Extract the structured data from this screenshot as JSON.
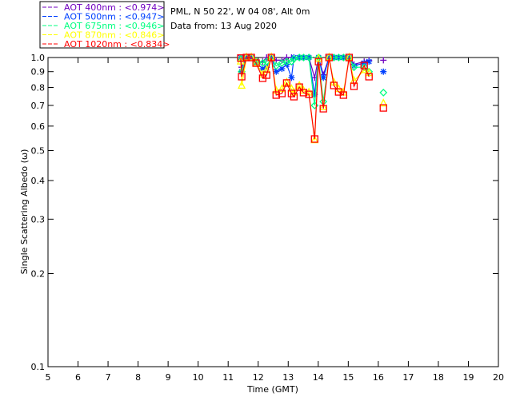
{
  "chart_data": {
    "type": "line",
    "title_lines": [
      "PML, N 50 22', W 04 08', Alt 0m",
      "Data from: 13 Aug 2020"
    ],
    "xlabel": "Time (GMT)",
    "ylabel": "Single Scattering Albedo (ω)",
    "xlim": [
      5,
      20
    ],
    "ylim": [
      0.1,
      1.0
    ],
    "yscale": "log",
    "xticks": [
      "5",
      "6",
      "7",
      "8",
      "9",
      "10",
      "11",
      "12",
      "13",
      "14",
      "15",
      "16",
      "17",
      "18",
      "19",
      "20"
    ],
    "yticks": [
      {
        "v": 1.0,
        "label": "1.0"
      },
      {
        "v": 0.9,
        "label": "0.9"
      },
      {
        "v": 0.8,
        "label": "0.8"
      },
      {
        "v": 0.7,
        "label": "0.7"
      },
      {
        "v": 0.6,
        "label": "0.6"
      },
      {
        "v": 0.5,
        "label": "0.5"
      },
      {
        "v": 0.4,
        "label": "0.4"
      },
      {
        "v": 0.3,
        "label": "0.3"
      },
      {
        "v": 0.2,
        "label": "0.2"
      },
      {
        "v": 0.1,
        "label": "0.1"
      }
    ],
    "legend_position": "top-left-outside",
    "x": [
      11.42,
      11.45,
      11.61,
      11.77,
      11.93,
      12.15,
      12.28,
      12.44,
      12.6,
      12.79,
      12.95,
      13.11,
      13.19,
      13.37,
      13.51,
      13.69,
      13.88,
      14.01,
      14.17,
      14.36,
      14.52,
      14.68,
      14.84,
      15.03,
      15.19,
      15.53,
      15.69,
      16.17
    ],
    "series": [
      {
        "name": "AOT  400nm : <0.974>",
        "color": "#7000c0",
        "marker": "plus",
        "values": [
          1.0,
          0.93,
          1.0,
          1.0,
          0.97,
          0.97,
          1.0,
          1.0,
          0.98,
          0.98,
          1.0,
          1.0,
          1.0,
          1.0,
          1.0,
          1.0,
          0.86,
          1.0,
          0.88,
          1.0,
          1.0,
          1.0,
          1.0,
          1.0,
          0.95,
          0.97,
          0.98,
          0.98
        ]
      },
      {
        "name": "AOT  500nm : <0.947>",
        "color": "#0040ff",
        "marker": "asterisk",
        "values": [
          1.0,
          0.9,
          1.0,
          1.0,
          0.96,
          0.92,
          0.93,
          1.0,
          0.9,
          0.92,
          0.95,
          0.86,
          1.0,
          1.0,
          1.0,
          1.0,
          0.76,
          1.0,
          0.86,
          1.0,
          1.0,
          1.0,
          1.0,
          1.0,
          0.94,
          0.96,
          0.97,
          0.9
        ]
      },
      {
        "name": "AOT  675nm : <0.946>",
        "color": "#00ff80",
        "marker": "diamond",
        "values": [
          0.99,
          0.9,
          1.0,
          1.0,
          0.97,
          0.96,
          0.97,
          1.0,
          0.94,
          0.96,
          0.97,
          0.97,
          0.99,
          1.0,
          1.0,
          1.0,
          0.7,
          1.0,
          0.72,
          1.0,
          1.0,
          1.0,
          1.0,
          1.0,
          0.93,
          0.93,
          0.9,
          0.77
        ]
      },
      {
        "name": "AOT  870nm : <0.846>",
        "color": "#ffff00",
        "marker": "triangle",
        "values": [
          0.97,
          0.81,
          1.0,
          1.0,
          0.96,
          0.88,
          0.91,
          1.0,
          0.78,
          0.79,
          0.83,
          0.79,
          0.77,
          0.81,
          0.78,
          0.77,
          0.54,
          0.99,
          0.69,
          1.0,
          0.83,
          0.79,
          0.77,
          1.0,
          0.84,
          0.91,
          0.89,
          0.71
        ]
      },
      {
        "name": "AOT 1020nm : <0.834>",
        "color": "#ff0000",
        "marker": "square",
        "values": [
          0.996,
          0.867,
          1.0,
          1.0,
          0.959,
          0.857,
          0.877,
          1.0,
          0.756,
          0.765,
          0.827,
          0.765,
          0.747,
          0.802,
          0.77,
          0.76,
          0.545,
          0.97,
          0.683,
          1.0,
          0.812,
          0.774,
          0.756,
          1.0,
          0.807,
          0.942,
          0.867,
          0.687
        ]
      }
    ]
  }
}
